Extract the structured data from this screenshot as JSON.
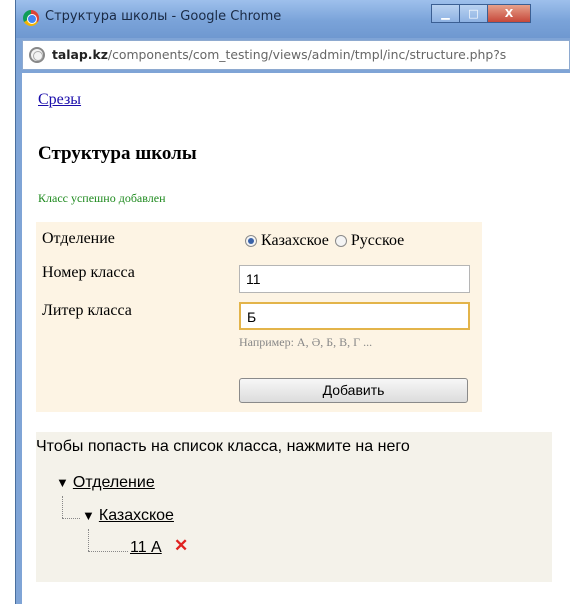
{
  "window": {
    "title": "Структура школы - Google Chrome",
    "controls": {
      "minimize": "▁",
      "maximize": "□",
      "close": "X"
    }
  },
  "addressbar": {
    "domain": "talap.kz",
    "path": "/components/com_testing/views/admin/tmpl/inc/structure.php?s"
  },
  "page": {
    "top_link": "Срезы",
    "title": "Структура школы",
    "success_message": "Класс успешно добавлен"
  },
  "form": {
    "department_label": "Отделение",
    "department_options": [
      {
        "label": "Казахское",
        "checked": true
      },
      {
        "label": "Русское",
        "checked": false
      }
    ],
    "class_number_label": "Номер класса",
    "class_number_value": "11",
    "class_letter_label": "Литер класса",
    "class_letter_value": "Б",
    "class_letter_hint": "Например: А, Ә, Б, В, Г ...",
    "add_button": "Добавить"
  },
  "tree": {
    "instruction": "Чтобы попасть на список класса, нажмите на него",
    "root": {
      "arrow": "▼",
      "label": "Отделение"
    },
    "branch": {
      "arrow": "▼",
      "label": "Казахское"
    },
    "leaf": {
      "label": "11 А",
      "delete_icon": "✕"
    }
  },
  "colors": {
    "success": "#1e8a1e",
    "form_background": "#fdf4e4",
    "tree_background": "#f4f2ea",
    "delete": "#e0211f",
    "link": "#1a0dab"
  }
}
